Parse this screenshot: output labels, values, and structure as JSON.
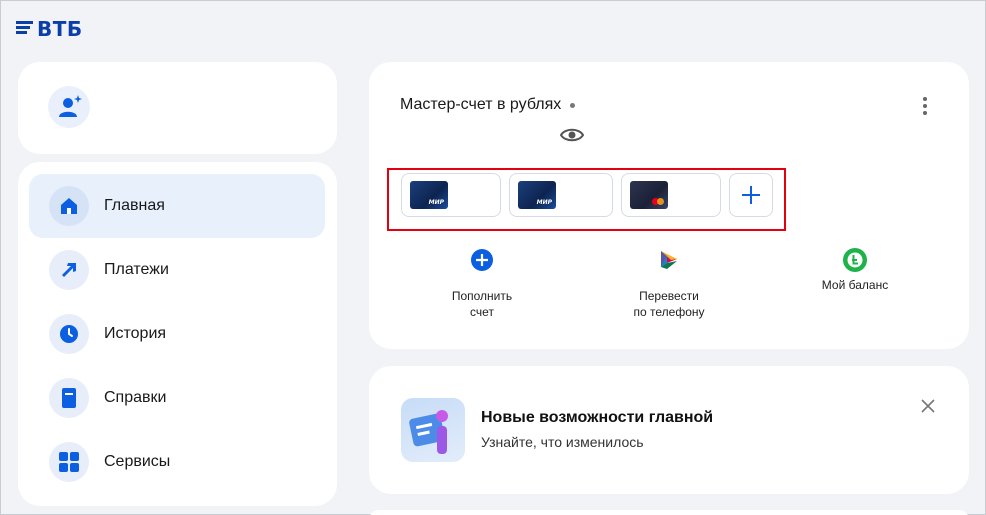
{
  "brand": {
    "name": "ВТБ"
  },
  "nav": {
    "items": [
      {
        "label": "Главная",
        "icon": "home-icon"
      },
      {
        "label": "Платежи",
        "icon": "payments-arrow-icon"
      },
      {
        "label": "История",
        "icon": "clock-icon"
      },
      {
        "label": "Справки",
        "icon": "document-icon"
      },
      {
        "label": "Сервисы",
        "icon": "grid-icon"
      }
    ],
    "active": "Главная"
  },
  "account": {
    "title": "Мастер-счет в рублях",
    "cards": [
      {
        "type": "МИР"
      },
      {
        "type": "МИР"
      },
      {
        "type": "Mastercard"
      }
    ],
    "actions": [
      {
        "label": "Пополнить\nсчет",
        "icon": "plus-circle-icon"
      },
      {
        "label": "Перевести\nпо телефону",
        "icon": "sbp-icon"
      },
      {
        "label": "Мой баланс",
        "icon": "balance-icon"
      }
    ]
  },
  "promo": {
    "title": "Новые возможности главной",
    "subtitle": "Узнайте, что изменилось"
  },
  "colors": {
    "brand": "#0a3ea8",
    "accent": "#0b5fe0",
    "highlight": "#e3000f",
    "green": "#1eb34a"
  }
}
